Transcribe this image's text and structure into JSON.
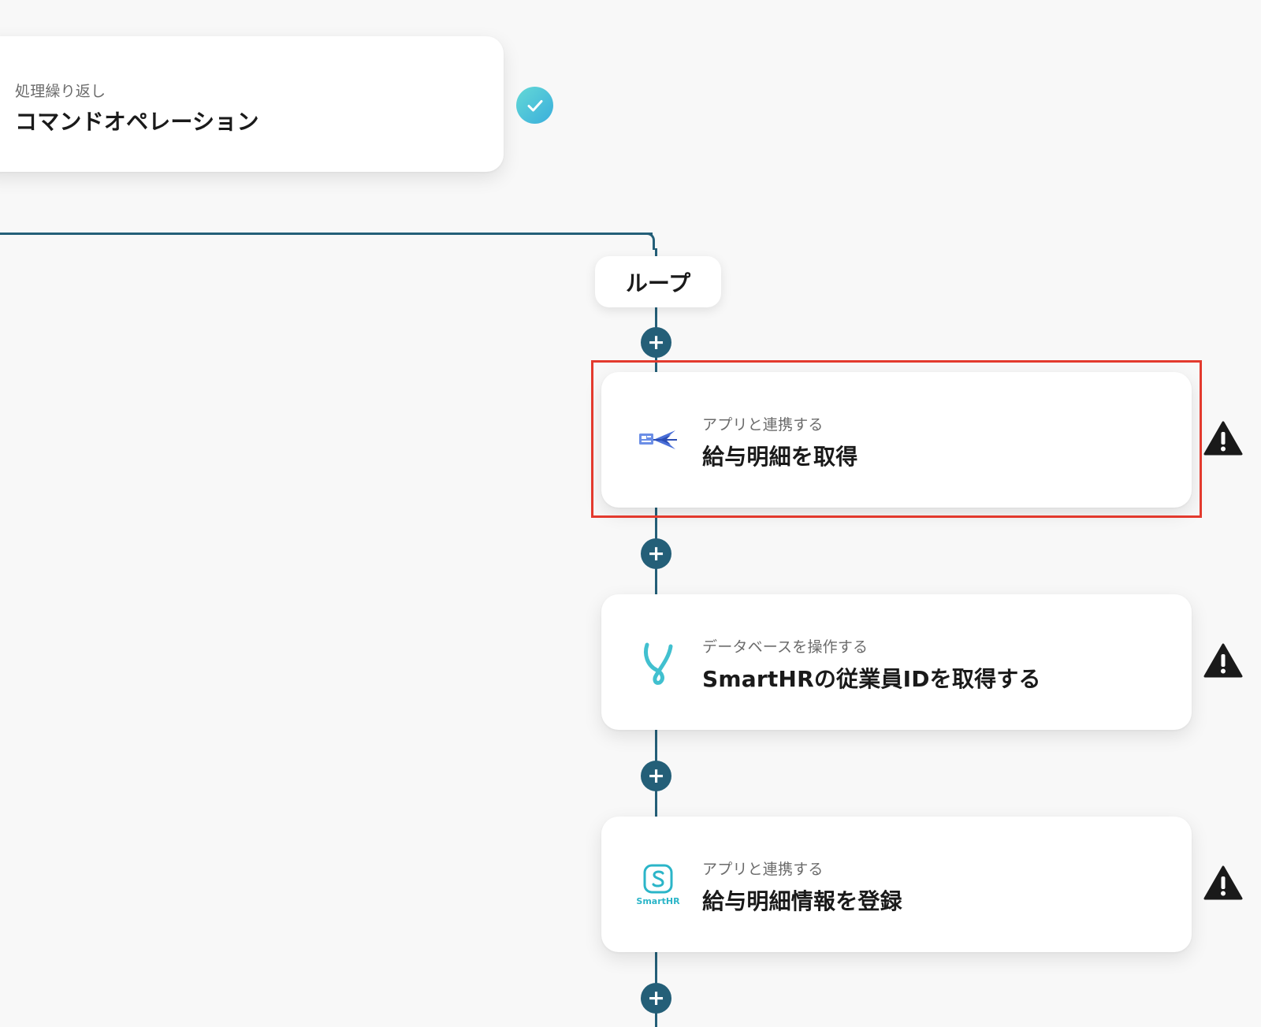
{
  "top_step": {
    "label": "処理繰り返し",
    "title": "コマンドオペレーション",
    "status_icon": "check-circle-icon"
  },
  "loop": {
    "label": "ループ"
  },
  "add_button": {
    "glyph": "+",
    "icon": "plus-icon"
  },
  "steps": [
    {
      "label": "アプリと連携する",
      "title": "給与明細を取得",
      "app_icon": "payroll-app-icon",
      "warning_icon": "warning-triangle-icon",
      "highlighted": true
    },
    {
      "label": "データベースを操作する",
      "title": "SmartHRの従業員IDを取得する",
      "app_icon": "yoom-database-icon",
      "warning_icon": "warning-triangle-icon",
      "highlighted": false
    },
    {
      "label": "アプリと連携する",
      "title": "給与明細情報を登録",
      "app_icon": "smarthr-logo-icon",
      "app_icon_text": "SmartHR",
      "warning_icon": "warning-triangle-icon",
      "highlighted": false
    }
  ],
  "colors": {
    "connector": "#245f78",
    "highlight": "#e33a2e",
    "check_gradient_start": "#64d9d6",
    "check_gradient_end": "#3aaedc",
    "smarthr_teal": "#2bb5c8"
  }
}
